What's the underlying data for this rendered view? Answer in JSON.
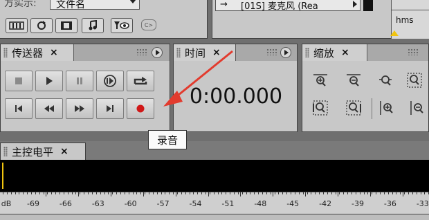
{
  "top": {
    "sort_label": "方实示:",
    "sort_value": "文件名",
    "track_label": "[01S] 麦克风 (Rea",
    "time_unit": "hms"
  },
  "transport": {
    "title": "传送器",
    "close": "×"
  },
  "time_panel": {
    "title": "时间",
    "close": "×",
    "value": "0:00.000"
  },
  "zoom_panel": {
    "title": "缩放",
    "close": "×"
  },
  "master_panel": {
    "title": "主控电平",
    "close": "×"
  },
  "tooltip": {
    "text": "录音"
  },
  "meter": {
    "unit": "dB",
    "ticks": [
      "-69",
      "-66",
      "-63",
      "-60",
      "-57",
      "-54",
      "-51",
      "-48",
      "-45",
      "-42",
      "-39",
      "-36",
      "-33"
    ]
  },
  "colors": {
    "record_red": "#d01818",
    "arrow_red": "#e23b2e",
    "panel_bg": "#c8c8c8"
  }
}
